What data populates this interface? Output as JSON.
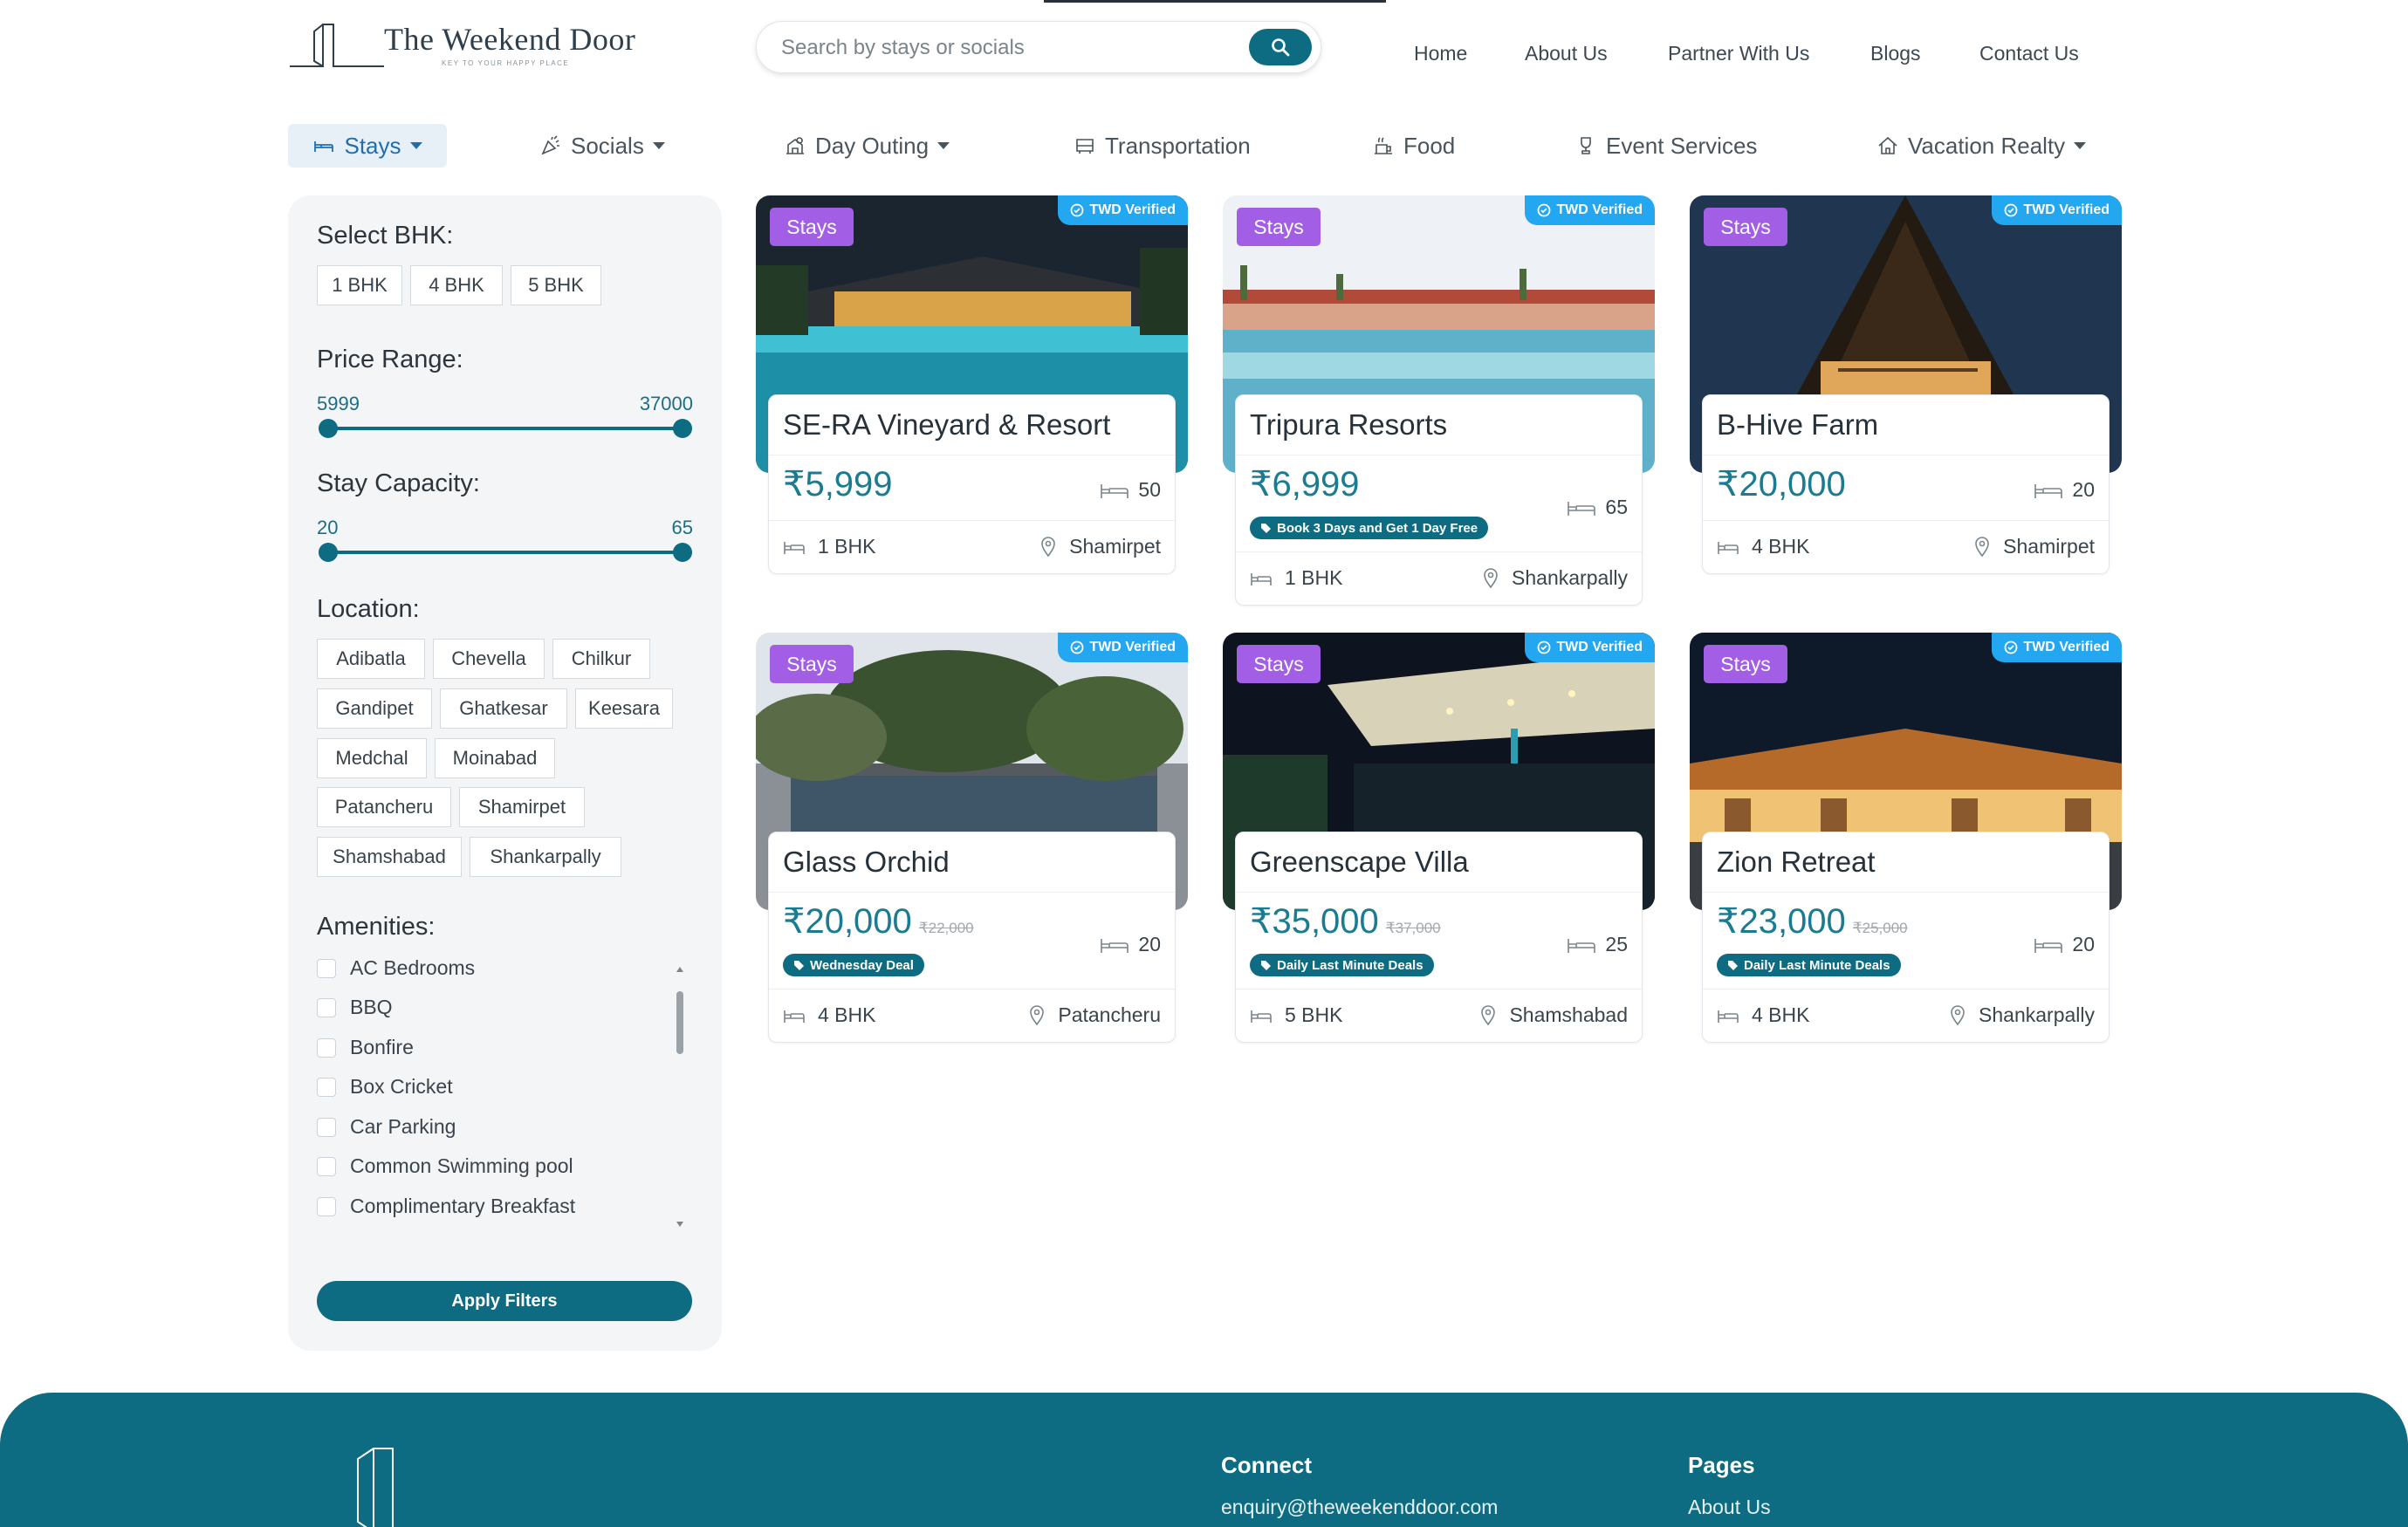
{
  "brand": {
    "title": "The Weekend Door",
    "tagline": "KEY TO YOUR HAPPY PLACE"
  },
  "search": {
    "placeholder": "Search by stays or socials"
  },
  "nav": [
    "Home",
    "About Us",
    "Partner With Us",
    "Blogs",
    "Contact Us"
  ],
  "categories": [
    {
      "label": "Stays",
      "dropdown": true,
      "active": true,
      "icon": "bed-icon"
    },
    {
      "label": "Socials",
      "dropdown": true,
      "icon": "party-icon"
    },
    {
      "label": "Day Outing",
      "dropdown": true,
      "icon": "outing-icon"
    },
    {
      "label": "Transportation",
      "dropdown": false,
      "icon": "bus-icon"
    },
    {
      "label": "Food",
      "dropdown": false,
      "icon": "food-icon"
    },
    {
      "label": "Event Services",
      "dropdown": false,
      "icon": "trophy-icon"
    },
    {
      "label": "Vacation Realty",
      "dropdown": true,
      "icon": "house-icon"
    }
  ],
  "filters": {
    "bhk_heading": "Select BHK:",
    "bhk_options": [
      "1 BHK",
      "4 BHK",
      "5 BHK"
    ],
    "price_heading": "Price Range:",
    "price_min": "5999",
    "price_max": "37000",
    "capacity_heading": "Stay Capacity:",
    "capacity_min": "20",
    "capacity_max": "65",
    "location_heading": "Location:",
    "locations": [
      "Adibatla",
      "Chevella",
      "Chilkur",
      "Gandipet",
      "Ghatkesar",
      "Keesara",
      "Medchal",
      "Moinabad",
      "Patancheru",
      "Shamirpet",
      "Shamshabad",
      "Shankarpally"
    ],
    "amenities_heading": "Amenities:",
    "amenities": [
      "AC Bedrooms",
      "BBQ",
      "Bonfire",
      "Box Cricket",
      "Car Parking",
      "Common Swimming pool",
      "Complimentary Breakfast"
    ],
    "apply_label": "Apply Filters"
  },
  "listings": [
    {
      "tag": "Stays",
      "verified": "TWD Verified",
      "name": "SE-RA Vineyard & Resort",
      "price": "₹5,999",
      "old_price": "",
      "deal": "",
      "capacity": "50",
      "bhk": "1 BHK",
      "location": "Shamirpet"
    },
    {
      "tag": "Stays",
      "verified": "TWD Verified",
      "name": "Tripura Resorts",
      "price": "₹6,999",
      "old_price": "",
      "deal": "Book 3 Days and Get 1 Day Free",
      "capacity": "65",
      "bhk": "1 BHK",
      "location": "Shankarpally"
    },
    {
      "tag": "Stays",
      "verified": "TWD Verified",
      "name": "B-Hive Farm",
      "price": "₹20,000",
      "old_price": "",
      "deal": "",
      "capacity": "20",
      "bhk": "4 BHK",
      "location": "Shamirpet"
    },
    {
      "tag": "Stays",
      "verified": "TWD Verified",
      "name": "Glass Orchid",
      "price": "₹20,000",
      "old_price": "₹22,000",
      "deal": "Wednesday Deal",
      "capacity": "20",
      "bhk": "4 BHK",
      "location": "Patancheru"
    },
    {
      "tag": "Stays",
      "verified": "TWD Verified",
      "name": "Greenscape Villa",
      "price": "₹35,000",
      "old_price": "₹37,000",
      "deal": "Daily Last Minute Deals",
      "capacity": "25",
      "bhk": "5 BHK",
      "location": "Shamshabad"
    },
    {
      "tag": "Stays",
      "verified": "TWD Verified",
      "name": "Zion Retreat",
      "price": "₹23,000",
      "old_price": "₹25,000",
      "deal": "Daily Last Minute Deals",
      "capacity": "20",
      "bhk": "4 BHK",
      "location": "Shankarpally"
    }
  ],
  "footer": {
    "connect_heading": "Connect",
    "email": "enquiry@theweekenddoor.com",
    "pages_heading": "Pages",
    "pages_first": "About Us"
  },
  "colors": {
    "primary": "#0d6b82",
    "tag": "#a35ee6",
    "verified": "#22a7f0",
    "active_category": "#1f6fae"
  }
}
